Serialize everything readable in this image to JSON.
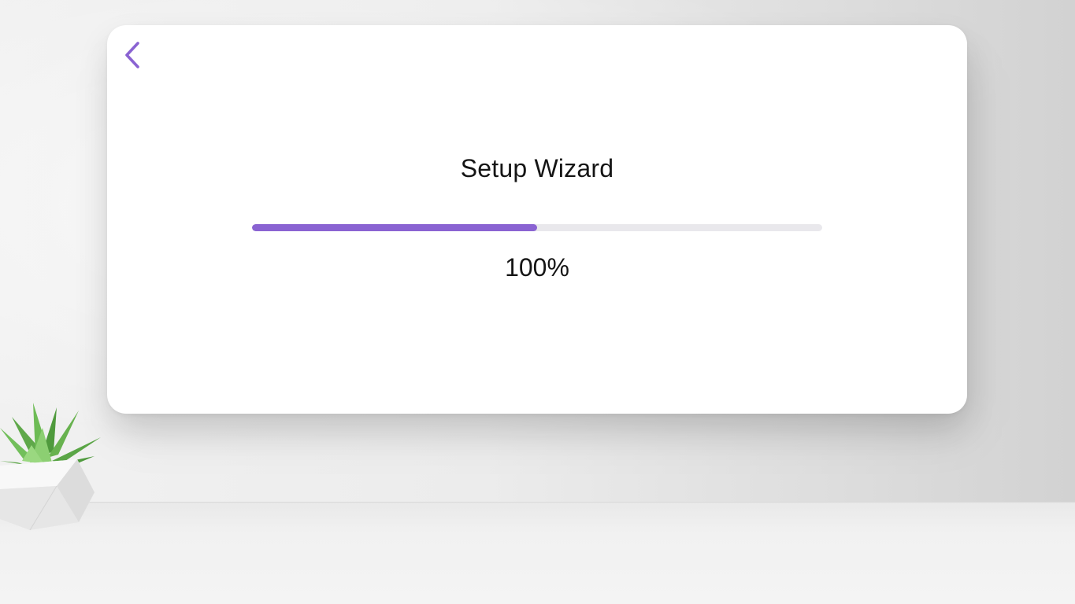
{
  "wizard": {
    "title": "Setup Wizard",
    "progress_text": "100%",
    "progress_fill_fraction": 0.5
  },
  "icons": {
    "back": "chevron-left-icon"
  },
  "colors": {
    "accent": "#8a63d2",
    "track": "#e9e8ec",
    "text": "#151515",
    "card": "#ffffff"
  }
}
